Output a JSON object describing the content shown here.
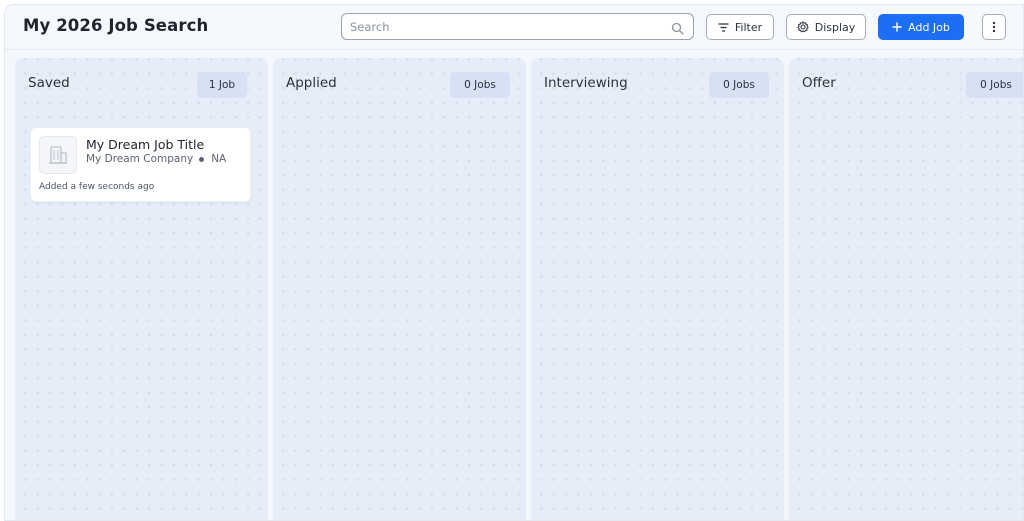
{
  "header": {
    "title": "My 2026 Job Search",
    "search_placeholder": "Search",
    "filter_label": "Filter",
    "display_label": "Display",
    "add_job_label": "Add Job"
  },
  "colors": {
    "accent": "#1c6ef2",
    "column_bg": "#e6edf9",
    "count_badge_bg": "#d6e2f4"
  },
  "icons": {
    "search": "search-icon",
    "filter": "filter-lines-icon",
    "display": "gear-icon",
    "add": "plus-icon",
    "more": "vertical-dots-icon",
    "company": "building-icon"
  },
  "columns": [
    {
      "name": "Saved",
      "count": "1 Job",
      "cards": [
        {
          "title": "My Dream Job Title",
          "company": "My Dream Company",
          "location": "NA",
          "added": "Added a few seconds ago"
        }
      ]
    },
    {
      "name": "Applied",
      "count": "0 Jobs",
      "cards": []
    },
    {
      "name": "Interviewing",
      "count": "0 Jobs",
      "cards": []
    },
    {
      "name": "Offer",
      "count": "0 Jobs",
      "cards": []
    }
  ]
}
